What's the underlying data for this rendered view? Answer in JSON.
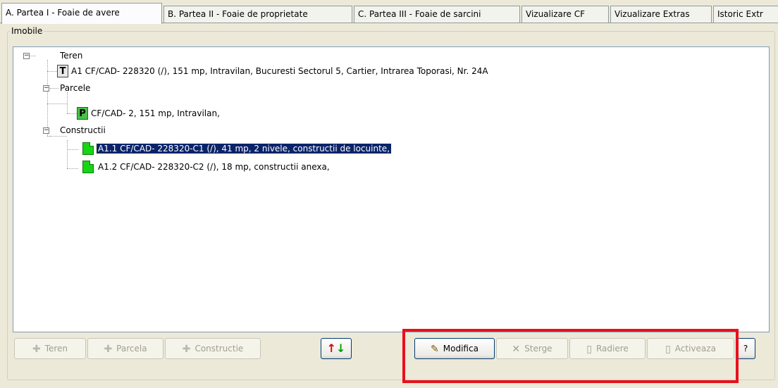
{
  "tabs": [
    {
      "label": "A. Partea I - Foaie de avere",
      "active": true
    },
    {
      "label": "B. Partea II - Foaie de proprietate",
      "active": false
    },
    {
      "label": "C. Partea III - Foaie de sarcini",
      "active": false
    },
    {
      "label": "Vizualizare CF",
      "active": false
    },
    {
      "label": "Vizualizare Extras",
      "active": false
    },
    {
      "label": "Istoric Extr",
      "active": false
    }
  ],
  "group": {
    "title": "Imobile"
  },
  "tree": {
    "teren": {
      "label": "Teren",
      "item": "A1 CF/CAD- 228320 (/), 151 mp, Intravilan, Bucuresti Sectorul 5, Cartier, Intrarea Toporasi, Nr. 24A",
      "icon": "T"
    },
    "parcele": {
      "label": "Parcele",
      "item": "CF/CAD- 2, 151 mp, Intravilan,",
      "icon": "P"
    },
    "constructii": {
      "label": "Constructii",
      "items": [
        "A1.1 CF/CAD- 228320-C1 (/), 41 mp, 2 nivele, constructii de locuinte,",
        "A1.2 CF/CAD- 228320-C2 (/), 18 mp, constructii anexa,"
      ],
      "selected_index": 0
    },
    "expander_symbol": "−"
  },
  "buttons": {
    "teren": "Teren",
    "parcela": "Parcela",
    "constructie": "Constructie",
    "modifica": "Modifica",
    "sterge": "Sterge",
    "radiere": "Radiere",
    "activeaza": "Activeaza",
    "help": "?",
    "sort_icon": "↑↓"
  },
  "colors": {
    "selection": "#0a246a",
    "highlight_box": "#e8101c",
    "sort_up": "#e00000",
    "sort_down": "#00a000"
  }
}
